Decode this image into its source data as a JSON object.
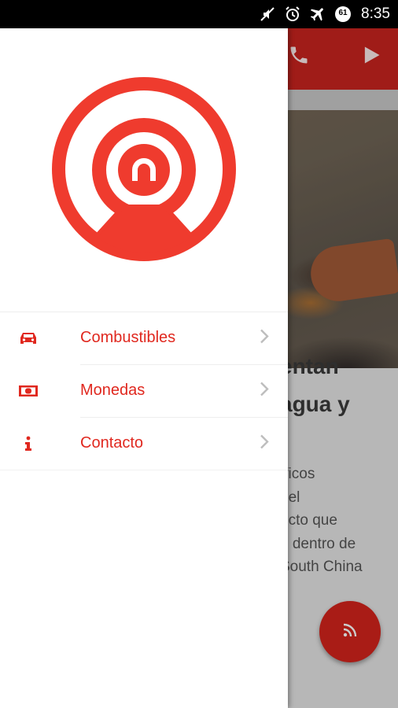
{
  "status_bar": {
    "time": "8:35",
    "notification_count": "61"
  },
  "menu": {
    "items": [
      {
        "label": "Combustibles",
        "icon": "car-icon"
      },
      {
        "label": "Monedas",
        "icon": "banknote-icon"
      },
      {
        "label": "Contacto",
        "icon": "info-icon"
      }
    ]
  },
  "background_article": {
    "headline_lines": [
      "entan",
      "agua y"
    ],
    "body_lines": [
      "íficos",
      "bel",
      "ucto que",
      "e dentro de",
      "South China"
    ]
  },
  "colors": {
    "accent": "#e0281f",
    "toolbar": "#c8231f",
    "fab": "#d4241c"
  }
}
